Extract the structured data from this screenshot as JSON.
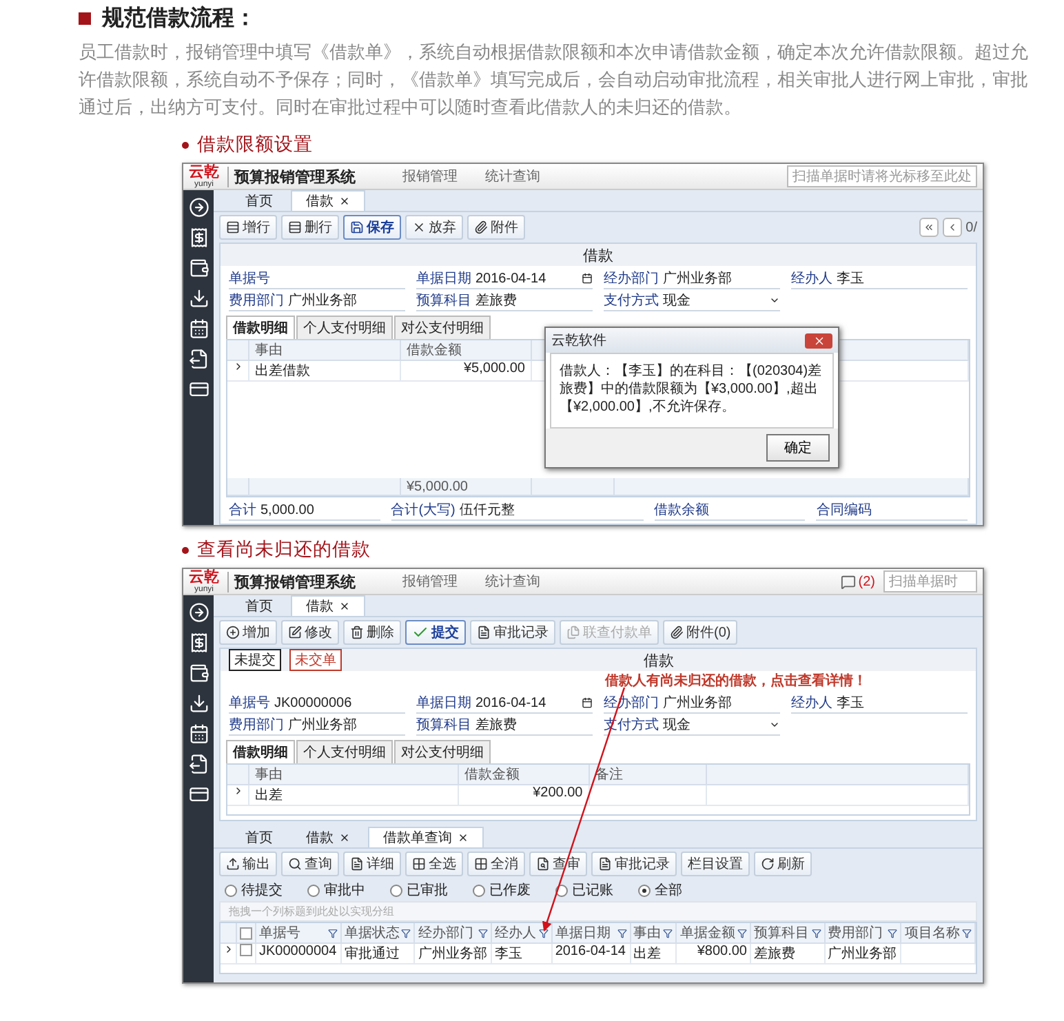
{
  "heading": "规范借款流程：",
  "intro": "员工借款时，报销管理中填写《借款单》，系统自动根据借款限额和本次申请借款金额，确定本次允许借款限额。超过允许借款限额，系统自动不予保存；同时，《借款单》填写完成后，会自动启动审批流程，相关审批人进行网上审批，审批通过后，出纳方可支付。同时在审批过程中可以随时查看此借款人的未归还的借款。",
  "sections": [
    {
      "title": "借款限额设置",
      "app": {
        "logo": "云乾",
        "logo_sub": "yunyi",
        "system_title": "预算报销管理系统",
        "menu": [
          "报销管理",
          "统计查询"
        ],
        "search_placeholder": "扫描单据时请将光标移至此处",
        "tabs": [
          {
            "label": "首页",
            "selected": false,
            "closable": false
          },
          {
            "label": "借款",
            "selected": true,
            "closable": true
          }
        ],
        "toolbar": [
          {
            "label": "增行",
            "primary": false,
            "disabled": false
          },
          {
            "label": "删行",
            "primary": false,
            "disabled": false
          },
          {
            "label": "保存",
            "primary": true,
            "disabled": false
          },
          {
            "label": "放弃",
            "primary": false,
            "disabled": false
          },
          {
            "label": "附件",
            "primary": false,
            "disabled": false
          }
        ],
        "pager": "0/",
        "form_title": "借款",
        "fields": [
          {
            "label": "单据号",
            "kind": "text"
          },
          {
            "label": "单据日期",
            "value": "2016-04-14",
            "kind": "date"
          },
          {
            "label": "经办部门",
            "value": "广州业务部",
            "kind": "text"
          },
          {
            "label": "经办人",
            "value": "李玉",
            "kind": "text"
          },
          {
            "label": "费用部门",
            "value": "广州业务部",
            "kind": "text"
          },
          {
            "label": "预算科目",
            "value": "差旅费",
            "kind": "text"
          },
          {
            "label": "支付方式",
            "value": "现金",
            "kind": "select"
          }
        ],
        "detail_tabs": [
          {
            "label": "借款明细",
            "selected": true
          },
          {
            "label": "个人支付明细",
            "selected": false
          },
          {
            "label": "对公支付明细",
            "selected": false
          }
        ],
        "detail_columns": [
          "事由",
          "借款金额"
        ],
        "detail_rows": [
          {
            "reason": "出差借款",
            "amount": "¥5,000.00"
          }
        ],
        "detail_total": "¥5,000.00",
        "footer": [
          {
            "label": "合计",
            "value": "5,000.00"
          },
          {
            "label": "合计(大写)",
            "value": "伍仟元整"
          },
          {
            "label": "借款余额"
          },
          {
            "label": "合同编码"
          }
        ],
        "dialog": {
          "title": "云乾软件",
          "message": "借款人：【李玉】的在科目：【(020304)差旅费】中的借款限额为【¥3,000.00】,超出【¥2,000.00】,不允许保存。",
          "button": "确定"
        }
      }
    },
    {
      "title": "查看尚未归还的借款",
      "app": {
        "logo": "云乾",
        "logo_sub": "yunyi",
        "system_title": "预算报销管理系统",
        "menu": [
          "报销管理",
          "统计查询"
        ],
        "notification_count": "(2)",
        "search_placeholder": "扫描单据时",
        "tabs": [
          {
            "label": "首页",
            "selected": false,
            "closable": false
          },
          {
            "label": "借款",
            "selected": true,
            "closable": true
          }
        ],
        "toolbar": [
          {
            "label": "增加",
            "primary": false,
            "disabled": false
          },
          {
            "label": "修改",
            "primary": false,
            "disabled": false
          },
          {
            "label": "删除",
            "primary": false,
            "disabled": false
          },
          {
            "label": "提交",
            "primary": true,
            "disabled": false
          },
          {
            "label": "审批记录",
            "primary": false,
            "disabled": false
          },
          {
            "label": "联查付款单",
            "primary": false,
            "disabled": true
          },
          {
            "label": "附件(0)",
            "primary": false,
            "disabled": false
          }
        ],
        "status_tags": [
          {
            "label": "未提交",
            "color": "#222222"
          },
          {
            "label": "未交单",
            "color": "#c0392b"
          }
        ],
        "form_title": "借款",
        "notice": "借款人有尚未归还的借款，点击查看详情！",
        "fields": [
          {
            "label": "单据号",
            "value": "JK00000006",
            "kind": "text"
          },
          {
            "label": "单据日期",
            "value": "2016-04-14",
            "kind": "date"
          },
          {
            "label": "经办部门",
            "value": "广州业务部",
            "kind": "text"
          },
          {
            "label": "经办人",
            "value": "李玉",
            "kind": "text"
          },
          {
            "label": "费用部门",
            "value": "广州业务部",
            "kind": "text"
          },
          {
            "label": "预算科目",
            "value": "差旅费",
            "kind": "text"
          },
          {
            "label": "支付方式",
            "value": "现金",
            "kind": "select"
          }
        ],
        "detail_tabs": [
          {
            "label": "借款明细",
            "selected": true
          },
          {
            "label": "个人支付明细",
            "selected": false
          },
          {
            "label": "对公支付明细",
            "selected": false
          }
        ],
        "detail_columns": [
          "事由",
          "借款金额",
          "备注"
        ],
        "detail_rows": [
          {
            "reason": "出差",
            "amount": "¥200.00"
          }
        ],
        "query": {
          "tabs": [
            {
              "label": "首页",
              "selected": false,
              "closable": false
            },
            {
              "label": "借款",
              "selected": false,
              "closable": true
            },
            {
              "label": "借款单查询",
              "selected": true,
              "closable": true
            }
          ],
          "toolbar": [
            "输出",
            "查询",
            "详细",
            "全选",
            "全消",
            "查审",
            "审批记录",
            "栏目设置",
            "刷新"
          ],
          "filters": [
            {
              "label": "待提交",
              "selected": false
            },
            {
              "label": "审批中",
              "selected": false
            },
            {
              "label": "已审批",
              "selected": false
            },
            {
              "label": "已作废",
              "selected": false
            },
            {
              "label": "已记账",
              "selected": false
            },
            {
              "label": "全部",
              "selected": true
            }
          ],
          "group_hint": "拖拽一个列标题到此处以实现分组",
          "all_checked": false,
          "columns": [
            "单据号",
            "单据状态",
            "经办部门",
            "经办人",
            "单据日期",
            "事由",
            "单据金额",
            "预算科目",
            "费用部门",
            "项目名称"
          ],
          "rows": [
            {
              "checked": false,
              "cells": [
                "JK00000004",
                "审批通过",
                "广州业务部",
                "李玉",
                "2016-04-14",
                "出差",
                "¥800.00",
                "差旅费",
                "广州业务部"
              ]
            }
          ]
        }
      }
    }
  ]
}
